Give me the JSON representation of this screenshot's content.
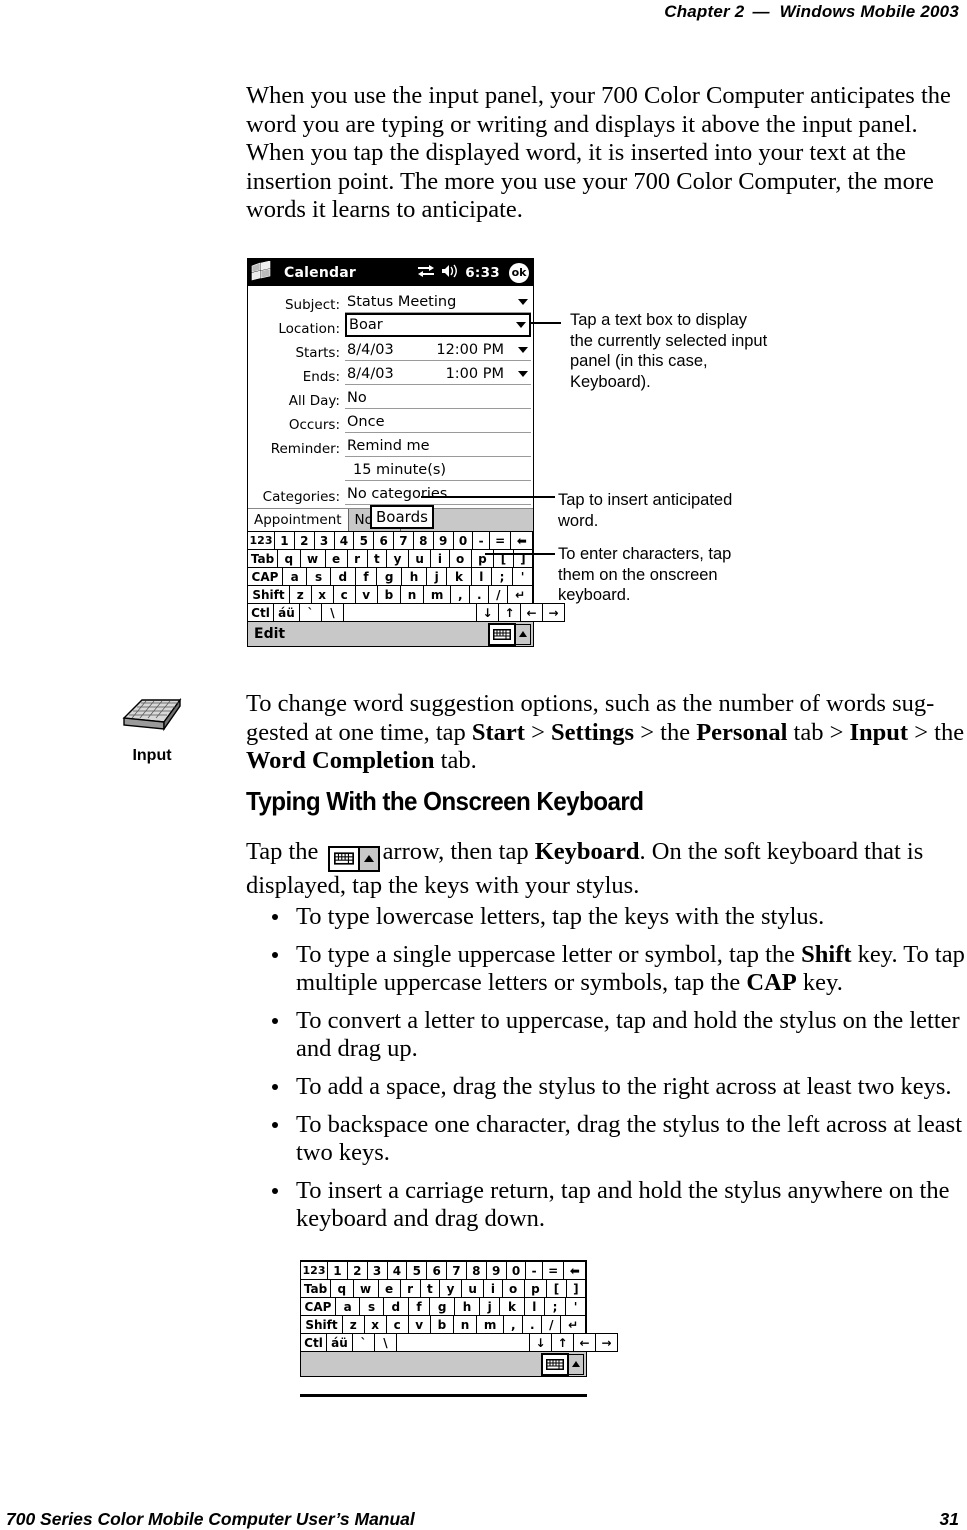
{
  "running_head": {
    "chapter": "Chapter  2",
    "dash": "—",
    "title": "Windows Mobile 2003"
  },
  "intro_paragraph": "When you use the input panel, your 700 Color Computer anticipates the word you are typing or writing and displays it above the input panel. When you tap the displayed word, it is inserted into your text at the insertion point. The more you use your 700 Color Computer, the more words it learns to anticipate.",
  "pda_figure": {
    "titlebar": {
      "app_title": "Calendar",
      "clock": "6:33",
      "ok_label": "ok",
      "icons": [
        "windows-start-logo",
        "connectivity-icon",
        "volume-icon",
        "ok-button"
      ]
    },
    "form_rows": [
      {
        "label": "Subject:",
        "value": "Status Meeting",
        "value2": "",
        "caret": true,
        "boxed": false
      },
      {
        "label": "Location:",
        "value": "Boar",
        "value2": "",
        "caret": true,
        "boxed": true
      },
      {
        "label": "Starts:",
        "value": "8/4/03",
        "value2": "12:00 PM",
        "caret": true,
        "boxed": false
      },
      {
        "label": "Ends:",
        "value": "8/4/03",
        "value2": "1:00 PM",
        "caret": true,
        "boxed": false
      },
      {
        "label": "All Day:",
        "value": "No",
        "value2": "",
        "caret": false,
        "boxed": false
      },
      {
        "label": "Occurs:",
        "value": "Once",
        "value2": "",
        "caret": false,
        "boxed": false
      },
      {
        "label": "Reminder:",
        "value": "Remind me",
        "value2": "",
        "caret": false,
        "boxed": false
      },
      {
        "label": "",
        "value": "15    minute(s)",
        "value2": "",
        "caret": false,
        "boxed": false
      },
      {
        "label": "Categories:",
        "value": "No categories...",
        "value2": "",
        "caret": false,
        "boxed": false
      }
    ],
    "tabs": [
      "Appointment",
      "Notes"
    ],
    "word_suggestion": "Boards",
    "status_bar_label": "Edit"
  },
  "keyboard": {
    "rows": [
      [
        "123",
        "1",
        "2",
        "3",
        "4",
        "5",
        "6",
        "7",
        "8",
        "9",
        "0",
        "-",
        "=",
        "⬅"
      ],
      [
        "Tab",
        "q",
        "w",
        "e",
        "r",
        "t",
        "y",
        "u",
        "i",
        "o",
        "p",
        "[",
        "]"
      ],
      [
        "CAP",
        "a",
        "s",
        "d",
        "f",
        "g",
        "h",
        "j",
        "k",
        "l",
        ";",
        "'"
      ],
      [
        "Shift",
        "z",
        "x",
        "c",
        "v",
        "b",
        "n",
        "m",
        ",",
        ".",
        "/",
        "↵"
      ],
      [
        "Ctl",
        "áü",
        "`",
        "\\",
        "",
        "↓",
        "↑",
        "←",
        "→"
      ]
    ]
  },
  "callouts": [
    {
      "id": "callout-textbox",
      "text": "Tap a text box to display the currently selected input panel (in this case, Keyboard)."
    },
    {
      "id": "callout-anticipated",
      "text": "Tap to insert anticipated word."
    },
    {
      "id": "callout-onscreen",
      "text": "To enter characters, tap them on the onscreen keyboard."
    }
  ],
  "margin_note": {
    "icon_name": "input-keyboard-icon",
    "icon_label": "Input",
    "paragraph_parts": [
      {
        "text": "To change word suggestion options, such as the number of words sug-gested at one time, tap ",
        "bold": false
      },
      {
        "text": "Start",
        "bold": true
      },
      {
        "text": " > ",
        "bold": false
      },
      {
        "text": "Settings",
        "bold": true
      },
      {
        "text": " > the ",
        "bold": false
      },
      {
        "text": "Personal",
        "bold": true
      },
      {
        "text": " tab > ",
        "bold": false
      },
      {
        "text": "Input",
        "bold": true
      },
      {
        "text": " > the ",
        "bold": false
      },
      {
        "text": "Word Completion",
        "bold": true
      },
      {
        "text": " tab.",
        "bold": false
      }
    ]
  },
  "section": {
    "heading": "Typing With the Onscreen Keyboard",
    "intro_before_icon": "Tap the",
    "intro_after_icon_1": "arrow, then tap ",
    "intro_keyboard_bold": "Keyboard",
    "intro_after_icon_2": ". On the soft keyboard that is displayed, tap the keys with your stylus."
  },
  "bullets": [
    "To type lowercase letters, tap the keys with the stylus.",
    "To type a single uppercase letter or symbol, tap the Shift key. To tap multiple uppercase letters or symbols, tap the CAP key.",
    "To convert a letter to uppercase, tap and hold the stylus on the letter and drag up.",
    "To add a space, drag the stylus to the right across at least two keys.",
    "To backspace one character, drag the stylus to the left across at least two keys.",
    "To insert a carriage return, tap and hold the stylus anywhere on the keyboard and drag down."
  ],
  "bullet_bold_terms": [
    "Shift",
    "CAP"
  ],
  "footer": {
    "left": "700 Series Color Mobile Computer User’s Manual",
    "page": "31"
  }
}
